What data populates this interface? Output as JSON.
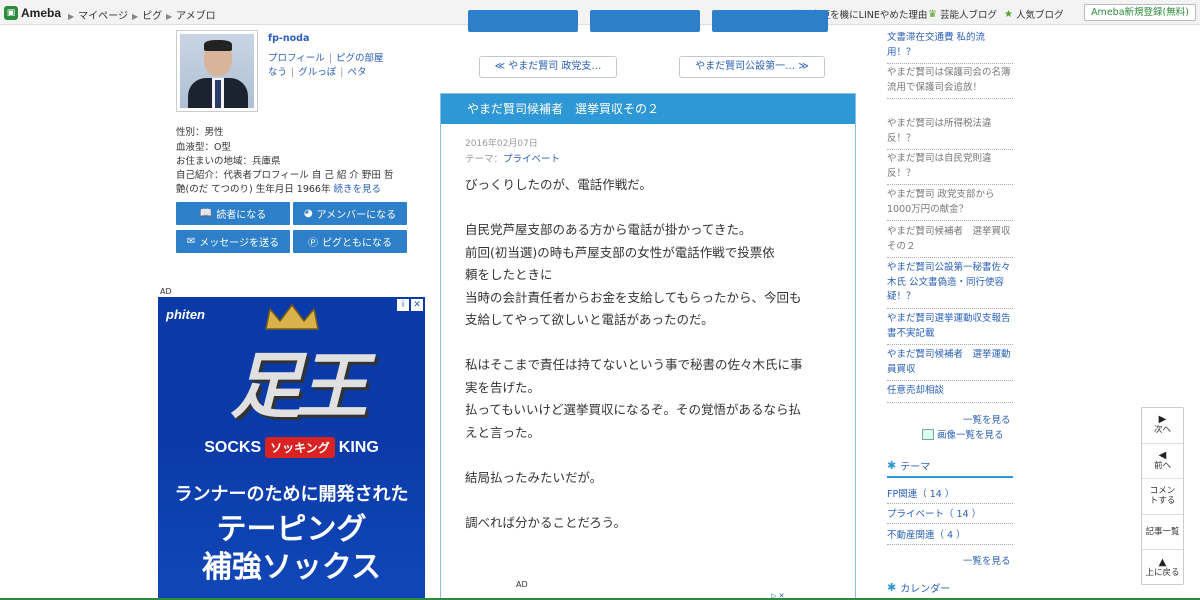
{
  "topbar": {
    "logo_text": "Ameba",
    "nav": [
      "マイページ",
      "ピグ",
      "アメブロ"
    ],
    "news_text": "機種変更を機にLINEやめた理由",
    "geinin_label": "芸能人ブログ",
    "popular_label": "人気ブログ",
    "register_label": "Ameba新規登録(無料)"
  },
  "profile": {
    "name": "fp-noda",
    "link_profile": "プロフィール",
    "link_pig_room": "ピグの部屋",
    "link_nau": "なう",
    "link_gurutto": "グルっぽ",
    "link_peta": "ペタ",
    "gender": "性別：男性",
    "blood": "血液型：O型",
    "location": "お住まいの地域：兵庫県",
    "intro_line1": "自己紹介：代表者プロフィール 自 己 紹 介 野田 哲",
    "intro_line2": "艶(のだ てつのり) 生年月日 1966年",
    "more": "続きを見る",
    "btn_reader": "読者になる",
    "btn_amember": "アメンバーになる",
    "btn_message": "メッセージを送る",
    "btn_pigtomo": "ピグともになる"
  },
  "ad_left": {
    "label": "AD",
    "brand": "phiten",
    "logo": "足王",
    "socks": "SOCKS",
    "socking": "ソッキング",
    "king": "KING",
    "line1": "ランナーのために開発された",
    "line2": "テーピング",
    "line3": "補強ソックス",
    "close": "✕",
    "info": "i"
  },
  "pager": {
    "prev": "≪ やまだ賢司 政党支…",
    "next": "やまだ賢司公設第一… ≫"
  },
  "entry": {
    "title": "やまだ賢司候補者　選挙買収その２",
    "date": "2016年02月07日",
    "theme_label": "テーマ：",
    "theme": "プライベート",
    "paragraphs": [
      [
        "びっくりしたのが、電話作戦だ。"
      ],
      [
        "自民党芦屋支部のある方から電話が掛かってきた。",
        "前回(初当選)の時も芦屋支部の女性が電話作戦で投票依",
        "頼をしたときに",
        "当時の会計責任者からお金を支給してもらったから、今回も",
        "支給してやって欲しいと電話があったのだ。"
      ],
      [
        "私はそこまで責任は持てないという事で秘書の佐々木氏に事",
        "実を告げた。",
        "払ってもいいけど選挙買収になるぞ。その覚悟があるなら払",
        "えと言った。"
      ],
      [
        "結局払ったみたいだが。"
      ],
      [
        "調べれば分かることだろう。"
      ]
    ],
    "ad_label": "AD"
  },
  "sidebar": {
    "recent": [
      {
        "text": "文書滞在交通費 私的流用！？",
        "visited": false
      },
      {
        "text": "やまだ賢司は保護司会の名簿流用で保護司会追放！",
        "visited": true
      },
      {
        "text": "やまだ賢司は所得税法違反！？",
        "visited": true
      },
      {
        "text": "やまだ賢司は自民党則違反！？",
        "visited": true
      },
      {
        "text": "やまだ賢司 政党支部から1000万円の献金？",
        "visited": true
      },
      {
        "text": "やまだ賢司候補者　選挙買収その２",
        "visited": true
      },
      {
        "text": "やまだ賢司公設第一秘書佐々木氏 公文書偽造・同行使容疑！？",
        "visited": false
      },
      {
        "text": "やまだ賢司選挙運動収支報告書不実記載",
        "visited": false
      },
      {
        "text": "やまだ賢司候補者　選挙運動員買収",
        "visited": false
      },
      {
        "text": "任意売却相談",
        "visited": false
      }
    ],
    "list_more": "一覧を見る",
    "image_list": "画像一覧を見る",
    "theme_header": "テーマ",
    "themes": [
      "FP関連（ 14 ）",
      "プライベート（ 14 ）",
      "不動産関連（ 4 ）"
    ],
    "theme_more": "一覧を見る",
    "calendar_header": "カレンダー"
  },
  "side_nav": {
    "next": "次へ",
    "prev": "前へ",
    "comment": "コメントする",
    "list": "記事一覧",
    "top": "上に戻る"
  },
  "colors": {
    "accent_blue": "#2e97d5",
    "button_blue": "#2e7fc9",
    "link_blue": "#2a5fb8",
    "ameba_green": "#2d8c3c"
  }
}
